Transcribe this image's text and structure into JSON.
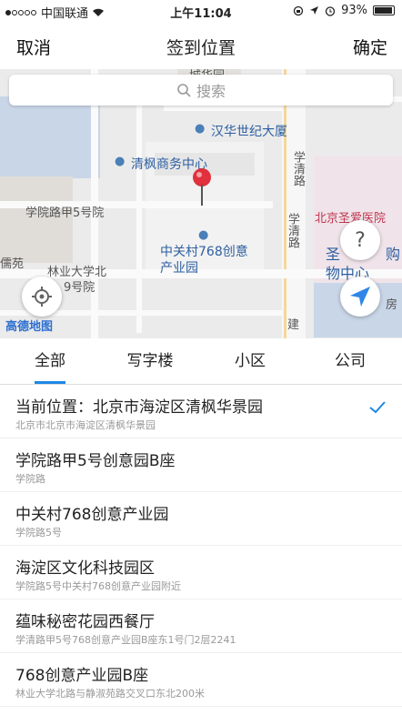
{
  "status": {
    "carrier": "中国联通",
    "time": "上午11:04",
    "battery": "93%"
  },
  "nav": {
    "cancel": "取消",
    "title": "签到位置",
    "confirm": "确定"
  },
  "map": {
    "search_placeholder": "搜索",
    "labels": {
      "l1": "城华园",
      "l2": "汉华世纪大厦",
      "l3": "清枫商务中心",
      "l4": "学院路甲5号院",
      "l5": "中关村768创意",
      "l6": "产业园",
      "l7": "林业大学北",
      "l8": "9号院",
      "l9": "北京圣爱医院",
      "l10": "学清路",
      "l11": "学清路",
      "l12": "圣",
      "l13": "购",
      "l14": "物中心",
      "l15": "房",
      "l16": "高德地图",
      "l17": "儒苑",
      "l18": "建"
    }
  },
  "tabs": [
    "全部",
    "写字楼",
    "小区",
    "公司"
  ],
  "places": [
    {
      "name": "当前位置：北京市海淀区清枫华景园",
      "addr": "北京市北京市海淀区清枫华景园",
      "selected": true
    },
    {
      "name": "学院路甲5号创意园B座",
      "addr": "学院路"
    },
    {
      "name": "中关村768创意产业园",
      "addr": "学院路5号"
    },
    {
      "name": "海淀区文化科技园区",
      "addr": "学院路5号中关村768创意产业园附近"
    },
    {
      "name": "蕴味秘密花园西餐厅",
      "addr": "学清路甲5号768创意产业园B座东1号门2层2241"
    },
    {
      "name": "768创意产业园B座",
      "addr": "林业大学北路与静淑苑路交叉口东北200米"
    }
  ]
}
